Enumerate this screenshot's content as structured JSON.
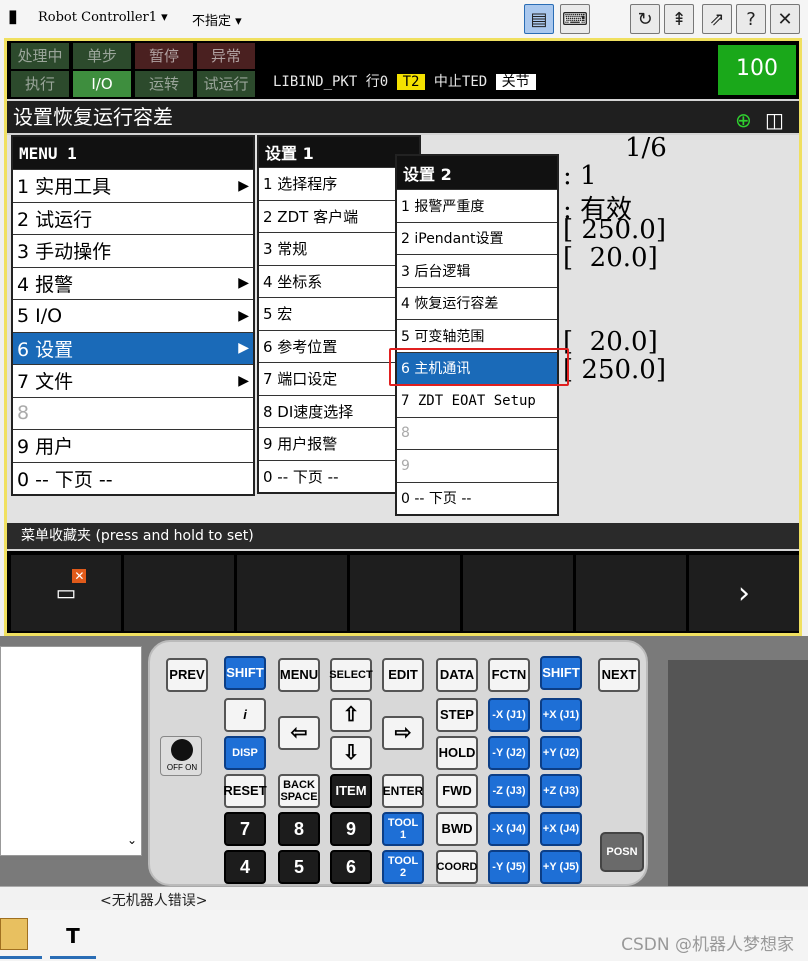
{
  "titlebar": {
    "controller": "Robot Controller1",
    "mode": "不指定"
  },
  "status": {
    "row1": [
      "处理中",
      "单步",
      "暂停",
      "异常"
    ],
    "row2": [
      "执行",
      "I/O",
      "运转",
      "试运行"
    ],
    "program": "LIBIND_PKT",
    "line": "行0",
    "mode_badge": "T2",
    "state": "中止TED",
    "joint_badge": "关节",
    "override": "100"
  },
  "header": {
    "title": "设置恢复运行容差"
  },
  "background_values": {
    "page": "1/6",
    "v1": ": 1",
    "v2": ": 有效",
    "v3": "[ 250.0]",
    "v4": "[  20.0]",
    "v5": "[  20.0]",
    "v6": "[ 250.0]"
  },
  "menu1": {
    "title": "MENU  1",
    "items": [
      {
        "label": "1 实用工具",
        "sub": "▶"
      },
      {
        "label": "2 试运行",
        "sub": ""
      },
      {
        "label": "3 手动操作",
        "sub": ""
      },
      {
        "label": "4 报警",
        "sub": "▶"
      },
      {
        "label": "5 I/O",
        "sub": "▶"
      },
      {
        "label": "6 设置",
        "sub": "▶"
      },
      {
        "label": "7 文件",
        "sub": "▶"
      },
      {
        "label": "8",
        "sub": ""
      },
      {
        "label": "9 用户",
        "sub": ""
      },
      {
        "label": "0 -- 下页 --",
        "sub": ""
      }
    ]
  },
  "menu2": {
    "title": "设置  1",
    "items": [
      "1 选择程序",
      "2 ZDT 客户端",
      "3 常规",
      "4 坐标系",
      "5 宏",
      "6 参考位置",
      "7 端口设定",
      "8 DI速度选择",
      "9 用户报警",
      "0 -- 下页 --"
    ]
  },
  "menu3": {
    "title": "设置  2",
    "items": [
      "1 报警严重度",
      "2 iPendant设置",
      "3 后台逻辑",
      "4 恢复运行容差",
      "5 可变轴范围",
      "6 主机通讯",
      "7 ZDT EOAT Setup",
      "8",
      "9",
      "0 -- 下页 --"
    ]
  },
  "favorites": "菜单收藏夹 (press and hold to set)",
  "keys": {
    "prev": "PREV",
    "shift": "SHIFT",
    "menu": "MENU",
    "select": "SELECT",
    "edit": "EDIT",
    "data": "DATA",
    "fctn": "FCTN",
    "next": "NEXT",
    "info": "i",
    "disp": "DISP",
    "step": "STEP",
    "hold": "HOLD",
    "fwd": "FWD",
    "bwd": "BWD",
    "coord": "COORD",
    "reset": "RESET",
    "backspace": "BACK SPACE",
    "item": "ITEM",
    "enter": "ENTER",
    "tool1": "TOOL 1",
    "tool2": "TOOL 2",
    "n7": "7",
    "n8": "8",
    "n9": "9",
    "n4": "4",
    "n5": "5",
    "n6": "6",
    "mx": "-X (J1)",
    "px": "+X (J1)",
    "my": "-Y (J2)",
    "py": "+Y (J2)",
    "mz": "-Z (J3)",
    "pz": "+Z (J3)",
    "mj4": "-X (J4)",
    "pj4": "+X (J4)",
    "mj5": "-Y (J5)",
    "pj5": "+Y (J5)",
    "posn": "POSN",
    "off_on": "OFF ON"
  },
  "bottom": {
    "alarm": "<无机器人错误>",
    "watermark": "CSDN @机器人梦想家",
    "task_t": "T"
  }
}
